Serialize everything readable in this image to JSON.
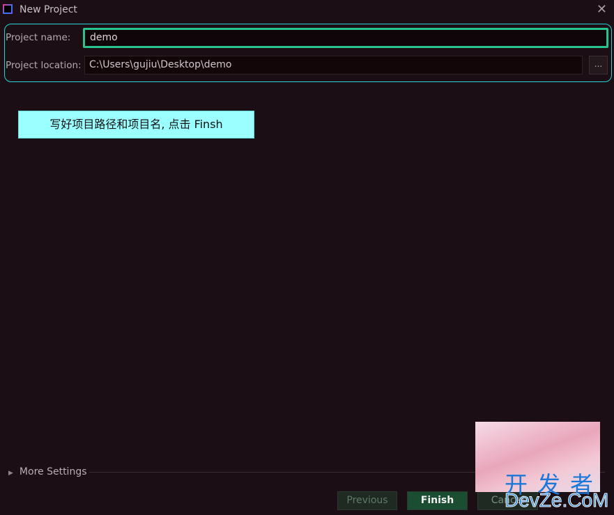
{
  "window": {
    "title": "New Project",
    "close_icon": "close-icon",
    "app_icon": "intellij-idea-icon"
  },
  "form": {
    "project_name_label": "Project name:",
    "project_name_value": "demo",
    "project_location_label": "Project location:",
    "project_location_value": "C:\\Users\\gujiu\\Desktop\\demo",
    "browse_label": "..."
  },
  "annotation": {
    "text": "写好项目路径和项目名, 点击 Finsh"
  },
  "more_settings": {
    "label": "More Settings"
  },
  "buttons": {
    "previous": "Previous",
    "finish": "Finish",
    "cancel": "Cancel"
  },
  "watermark": {
    "line1": "开发者",
    "line2": "DevZe.CoM"
  },
  "colors": {
    "background": "#1b0e14",
    "highlight": "#29d3d6",
    "focus": "#28c48e",
    "primary_button": "#1a4d31"
  }
}
